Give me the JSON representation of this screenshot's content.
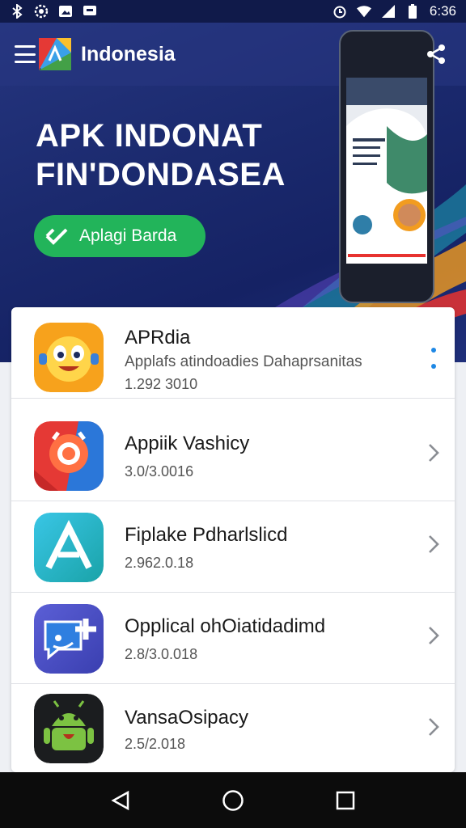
{
  "status_bar": {
    "time": "6:36",
    "left_icons": [
      "bluetooth-icon",
      "settings-icon",
      "gallery-icon",
      "message-icon"
    ],
    "right_icons": [
      "alarm-icon",
      "wifi-icon",
      "signal-icon",
      "battery-icon"
    ]
  },
  "app_bar": {
    "title": "Indonesia"
  },
  "hero": {
    "headline_line1": "APK INDONAT",
    "headline_line2": "FIN'DONDASEA",
    "cta_label": "Aplagi Barda"
  },
  "apps": [
    {
      "title": "APRdia",
      "description": "Applafs atindoadies Dahaprsanitas",
      "meta": "1.292 3010",
      "action": "more-icon"
    },
    {
      "title": "Appiik Vashicy",
      "meta": "3.0/3.0016",
      "action": "chevron-right-icon"
    },
    {
      "title": "Fiplake Pdharlslicd",
      "meta": "2.962.0.18",
      "action": "chevron-right-icon"
    },
    {
      "title": "Opplical ohOiatidadimd",
      "meta": "2.8/3.0.018",
      "action": "chevron-right-icon"
    },
    {
      "title": "VansaOsipacy",
      "meta": "2.5/2.018",
      "action": "chevron-right-icon"
    }
  ],
  "colors": {
    "hero_bg": "#1b2a6e",
    "cta": "#22b45a",
    "accent": "#1e88e5"
  },
  "nav_bar": {
    "buttons": [
      "back-icon",
      "home-icon",
      "recents-icon"
    ]
  }
}
